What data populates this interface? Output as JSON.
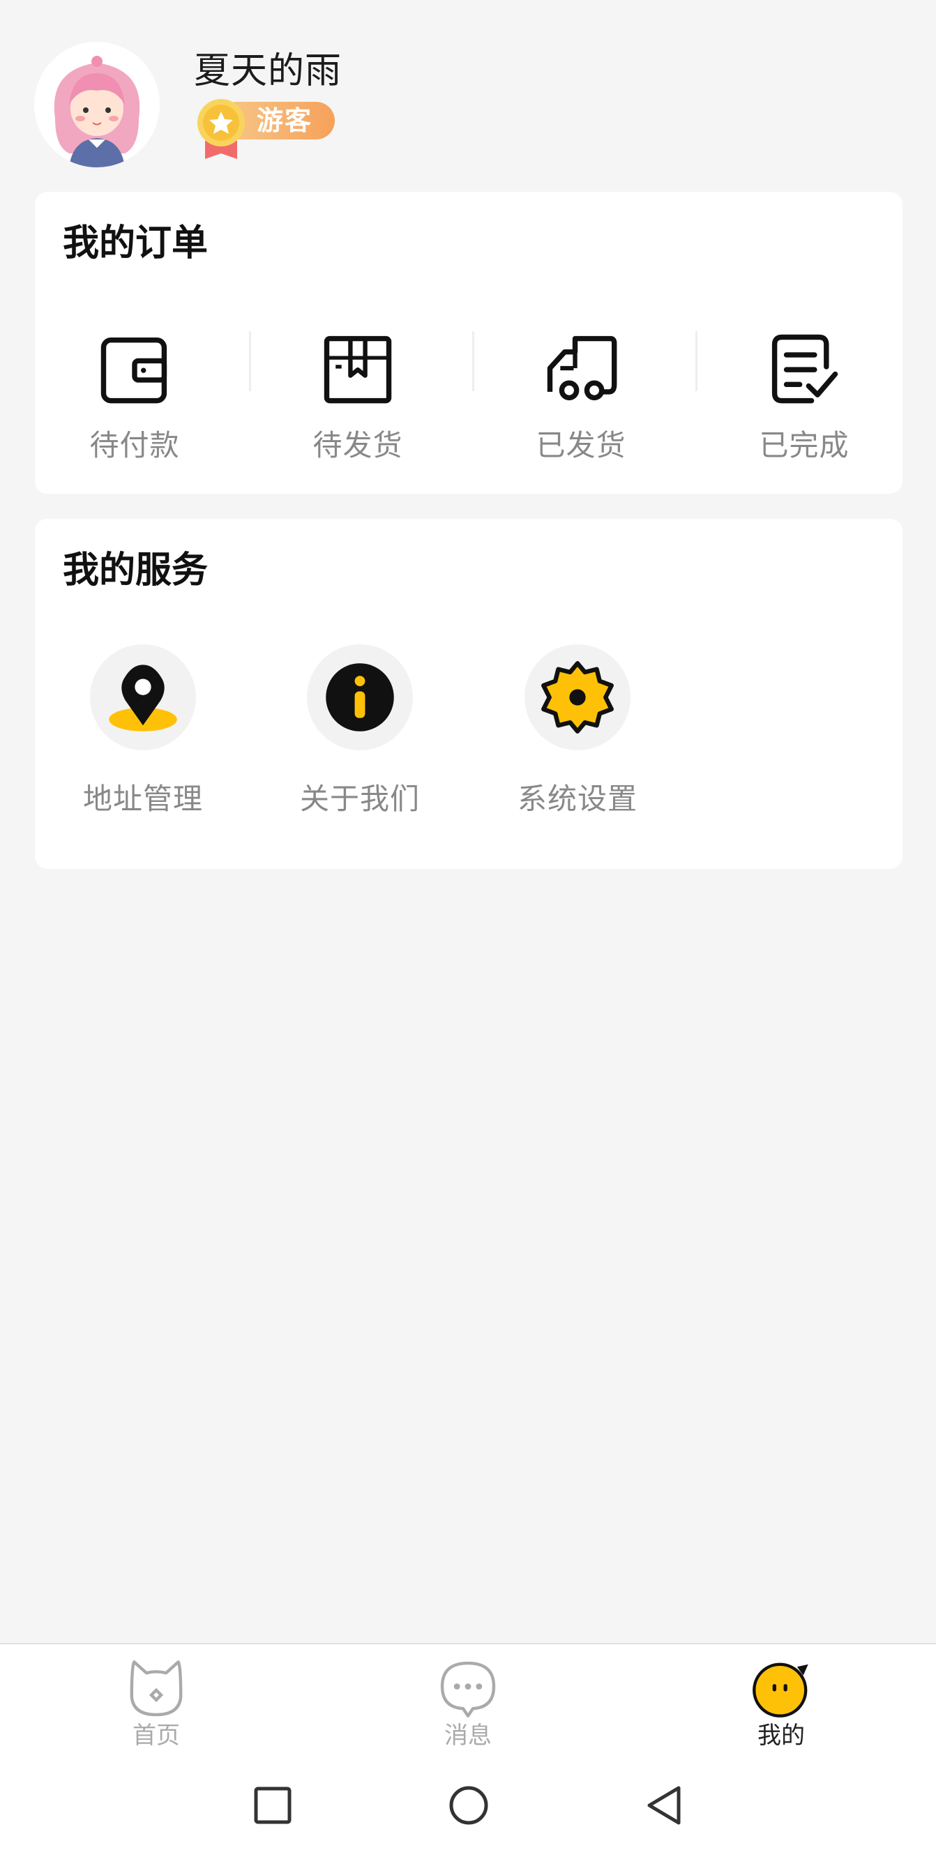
{
  "profile": {
    "name": "夏天的雨",
    "badge": "游客"
  },
  "orders": {
    "title": "我的订单",
    "items": [
      {
        "label": "待付款",
        "icon": "wallet-icon"
      },
      {
        "label": "待发货",
        "icon": "package-icon"
      },
      {
        "label": "已发货",
        "icon": "truck-icon"
      },
      {
        "label": "已完成",
        "icon": "checklist-icon"
      }
    ]
  },
  "services": {
    "title": "我的服务",
    "items": [
      {
        "label": "地址管理",
        "icon": "location-pin-icon"
      },
      {
        "label": "关于我们",
        "icon": "info-icon"
      },
      {
        "label": "系统设置",
        "icon": "settings-gear-icon"
      }
    ]
  },
  "tabbar": {
    "items": [
      {
        "label": "首页",
        "icon": "cat-home-icon",
        "active": false
      },
      {
        "label": "消息",
        "icon": "chat-bubble-icon",
        "active": false
      },
      {
        "label": "我的",
        "icon": "mine-face-icon",
        "active": true
      }
    ]
  },
  "colors": {
    "accent": "#ffc107",
    "background": "#f5f5f5",
    "label": "#888888",
    "badge_gradient_start": "#f7c98a",
    "badge_gradient_end": "#f6a15a"
  }
}
